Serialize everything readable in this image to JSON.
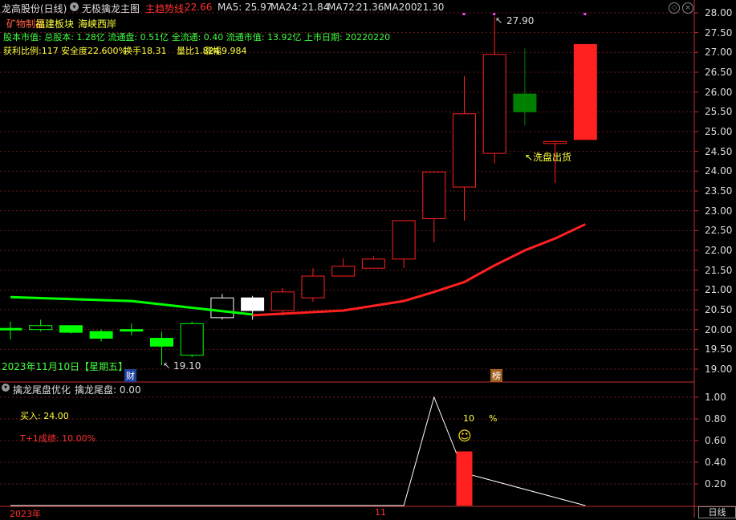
{
  "header": {
    "stock_name": "龙高股份(日线)",
    "indicator_name": "无极擒龙主图",
    "trend_label": "主趋势线:",
    "trend_value": "22.66",
    "ma": [
      {
        "label": "MA5:",
        "value": "25.97"
      },
      {
        "label": "MA24:",
        "value": "21.84"
      },
      {
        "label": "MA72:",
        "value": "21.36"
      },
      {
        "label": "MA200:",
        "value": "21.30"
      }
    ]
  },
  "info": {
    "sector_left": "矿物制品",
    "sector_right": "福建板块",
    "sector_extra": "海峡西岸",
    "capital_line": "股本市值: 总股本: 1.28亿 流通盘: 0.51亿 全流通: 0.40 流通市值: 13.92亿 上市日期: 20220220",
    "ratio_line_1": "获利比例:117",
    "ratio_line_2": "安全度22.600%",
    "ratio_line_3": "换手18.31",
    "ratio_line_4": "量比1.824",
    "ratio_line_5": "涨幅9.984"
  },
  "annotations": {
    "high_label": "27.90",
    "low_label": "19.10",
    "wash_label": "↖洗盘出货",
    "date_label": "2023年11月10日【星期五】",
    "badge_cai": "财",
    "badge_bang": "榜"
  },
  "y_axis_main": [
    "28.00",
    "27.50",
    "27.00",
    "26.50",
    "26.00",
    "25.50",
    "25.00",
    "24.50",
    "24.00",
    "23.50",
    "23.00",
    "22.50",
    "22.00",
    "21.50",
    "21.00",
    "20.50",
    "20.00",
    "19.50",
    "19.00"
  ],
  "sub": {
    "title": "擒龙尾盘优化",
    "value_label": "擒龙尾盘: 0.00",
    "buy_label": "买入: 24.00",
    "t1_label": "T+1成绩:  10.00%",
    "pct_num": "10",
    "pct_sign": "%",
    "smiley": "☺",
    "y_axis": [
      "1.00",
      "0.80",
      "0.60",
      "0.40",
      "0.20"
    ]
  },
  "bottom": {
    "year_label": "2023年",
    "month_label": "11",
    "period_button": "日线"
  },
  "colors": {
    "up": "#ff2020",
    "down_green": "#00ff00",
    "dark_green": "#008000",
    "header_red": "#ff3030",
    "yellow": "#ffff40",
    "cyan": "#40c0ff",
    "magenta": "#ff40ff"
  },
  "chart_data": {
    "type": "candlestick",
    "ylim": [
      18.85,
      28.25
    ],
    "candles": [
      {
        "o": 20.03,
        "h": 20.2,
        "l": 19.75,
        "c": 20.03,
        "color": "green"
      },
      {
        "o": 20.1,
        "h": 20.25,
        "l": 19.95,
        "c": 20.0,
        "color": "greenhollow"
      },
      {
        "o": 20.1,
        "h": 20.1,
        "l": 19.9,
        "c": 19.93,
        "color": "green"
      },
      {
        "o": 19.95,
        "h": 20.0,
        "l": 19.7,
        "c": 19.78,
        "color": "green"
      },
      {
        "o": 20.0,
        "h": 20.15,
        "l": 19.85,
        "c": 20.0,
        "color": "green"
      },
      {
        "o": 19.78,
        "h": 19.95,
        "l": 19.1,
        "c": 19.58,
        "color": "green"
      },
      {
        "o": 19.35,
        "h": 20.2,
        "l": 19.3,
        "c": 20.15,
        "color": "greenhollow"
      },
      {
        "o": 20.3,
        "h": 20.9,
        "l": 20.25,
        "c": 20.8,
        "color": "whitehollow"
      },
      {
        "o": 20.8,
        "h": 20.85,
        "l": 20.25,
        "c": 20.48,
        "color": "whitesolid"
      },
      {
        "o": 20.48,
        "h": 21.05,
        "l": 20.35,
        "c": 20.95,
        "color": "red"
      },
      {
        "o": 20.8,
        "h": 21.55,
        "l": 20.7,
        "c": 21.35,
        "color": "red"
      },
      {
        "o": 21.35,
        "h": 21.8,
        "l": 21.35,
        "c": 21.6,
        "color": "red"
      },
      {
        "o": 21.55,
        "h": 21.85,
        "l": 21.55,
        "c": 21.78,
        "color": "red"
      },
      {
        "o": 21.78,
        "h": 22.75,
        "l": 21.55,
        "c": 22.75,
        "color": "red"
      },
      {
        "o": 22.8,
        "h": 23.75,
        "l": 22.2,
        "c": 23.98,
        "color": "red"
      },
      {
        "o": 23.6,
        "h": 26.4,
        "l": 22.75,
        "c": 25.45,
        "color": "red"
      },
      {
        "o": 24.45,
        "h": 27.9,
        "l": 24.2,
        "c": 26.95,
        "color": "red"
      },
      {
        "o": 25.95,
        "h": 27.1,
        "l": 25.15,
        "c": 25.5,
        "color": "darkgreen"
      },
      {
        "o": 24.7,
        "h": 24.78,
        "l": 23.7,
        "c": 24.75,
        "color": "red"
      },
      {
        "o": 24.8,
        "h": 27.2,
        "l": 24.8,
        "c": 27.2,
        "color": "redsolid"
      }
    ],
    "trend_line": {
      "green": [
        [
          0,
          20.82
        ],
        [
          4,
          20.72
        ],
        [
          8,
          20.38
        ]
      ],
      "red": [
        [
          8,
          20.36
        ],
        [
          11,
          20.48
        ],
        [
          13,
          20.72
        ],
        [
          14,
          20.95
        ],
        [
          15,
          21.2
        ],
        [
          16,
          21.62
        ],
        [
          17,
          22.0
        ],
        [
          18,
          22.3
        ],
        [
          19,
          22.66
        ]
      ]
    },
    "sub_series": {
      "line": [
        [
          0,
          0
        ],
        [
          13,
          0
        ],
        [
          14,
          1.0
        ],
        [
          15,
          0.3
        ],
        [
          19,
          0
        ]
      ],
      "bar": {
        "index": 15,
        "value": 0.5
      }
    }
  }
}
